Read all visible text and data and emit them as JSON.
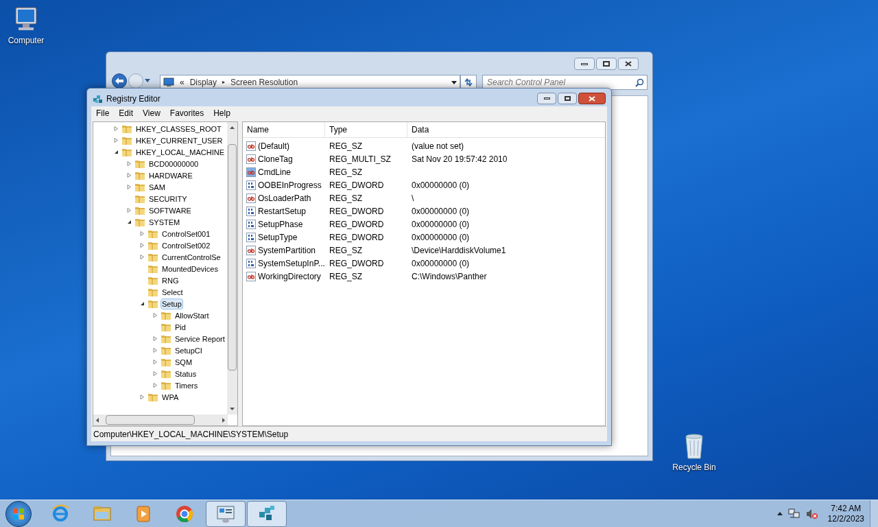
{
  "desktop_icons": [
    {
      "kind": "computer",
      "label": "Computer"
    },
    {
      "kind": "recycle-bin",
      "label": "Recycle Bin"
    }
  ],
  "control_panel": {
    "address": [
      {
        "kind": "chevrons",
        "text": "«"
      },
      {
        "kind": "crumb",
        "text": "Display"
      },
      {
        "kind": "sep",
        "text": "▸"
      },
      {
        "kind": "crumb",
        "text": "Screen Resolution"
      }
    ],
    "search": {
      "placeholder": "Search Control Panel"
    }
  },
  "registry_editor": {
    "title": "Registry Editor",
    "menu": [
      "File",
      "Edit",
      "View",
      "Favorites",
      "Help"
    ],
    "tree": [
      {
        "label": "HKEY_CLASSES_ROOT",
        "kind": "branch",
        "expanded": false,
        "selected": false
      },
      {
        "label": "HKEY_CURRENT_USER",
        "kind": "branch",
        "expanded": false,
        "selected": false
      },
      {
        "label": "HKEY_LOCAL_MACHINE",
        "kind": "branch",
        "expanded": true,
        "selected": false,
        "children": [
          {
            "label": "BCD00000000",
            "kind": "branch",
            "expanded": false,
            "selected": false
          },
          {
            "label": "HARDWARE",
            "kind": "branch",
            "expanded": false,
            "selected": false
          },
          {
            "label": "SAM",
            "kind": "branch",
            "expanded": false,
            "selected": false
          },
          {
            "label": "SECURITY",
            "kind": "leaf",
            "selected": false
          },
          {
            "label": "SOFTWARE",
            "kind": "branch",
            "expanded": false,
            "selected": false
          },
          {
            "label": "SYSTEM",
            "kind": "branch",
            "expanded": true,
            "selected": false,
            "children": [
              {
                "label": "ControlSet001",
                "kind": "branch",
                "expanded": false,
                "selected": false
              },
              {
                "label": "ControlSet002",
                "kind": "branch",
                "expanded": false,
                "selected": false
              },
              {
                "label": "CurrentControlSe",
                "kind": "branch",
                "expanded": false,
                "selected": false
              },
              {
                "label": "MountedDevices",
                "kind": "leaf",
                "selected": false
              },
              {
                "label": "RNG",
                "kind": "leaf",
                "selected": false
              },
              {
                "label": "Select",
                "kind": "leaf",
                "selected": false
              },
              {
                "label": "Setup",
                "kind": "branch",
                "expanded": true,
                "selected": true,
                "children": [
                  {
                    "label": "AllowStart",
                    "kind": "branch",
                    "expanded": false,
                    "selected": false
                  },
                  {
                    "label": "Pid",
                    "kind": "leaf",
                    "selected": false
                  },
                  {
                    "label": "Service Report",
                    "kind": "branch",
                    "expanded": false,
                    "selected": false
                  },
                  {
                    "label": "SetupCI",
                    "kind": "branch",
                    "expanded": false,
                    "selected": false
                  },
                  {
                    "label": "SQM",
                    "kind": "branch",
                    "expanded": false,
                    "selected": false
                  },
                  {
                    "label": "Status",
                    "kind": "branch",
                    "expanded": false,
                    "selected": false
                  },
                  {
                    "label": "Timers",
                    "kind": "branch",
                    "expanded": false,
                    "selected": false
                  }
                ]
              },
              {
                "label": "WPA",
                "kind": "branch",
                "expanded": false,
                "selected": false
              }
            ]
          }
        ]
      }
    ],
    "columns": [
      "Name",
      "Type",
      "Data"
    ],
    "rows": [
      {
        "kind": "string",
        "selected": false,
        "name": "(Default)",
        "type": "REG_SZ",
        "data": "(value not set)"
      },
      {
        "kind": "string",
        "selected": false,
        "name": "CloneTag",
        "type": "REG_MULTI_SZ",
        "data": "Sat Nov 20 19:57:42 2010"
      },
      {
        "kind": "string",
        "selected": true,
        "name": "CmdLine",
        "type": "REG_SZ",
        "data": ""
      },
      {
        "kind": "binary",
        "selected": false,
        "name": "OOBEInProgress",
        "type": "REG_DWORD",
        "data": "0x00000000 (0)"
      },
      {
        "kind": "string",
        "selected": false,
        "name": "OsLoaderPath",
        "type": "REG_SZ",
        "data": "\\"
      },
      {
        "kind": "binary",
        "selected": false,
        "name": "RestartSetup",
        "type": "REG_DWORD",
        "data": "0x00000000 (0)"
      },
      {
        "kind": "binary",
        "selected": false,
        "name": "SetupPhase",
        "type": "REG_DWORD",
        "data": "0x00000000 (0)"
      },
      {
        "kind": "binary",
        "selected": false,
        "name": "SetupType",
        "type": "REG_DWORD",
        "data": "0x00000000 (0)"
      },
      {
        "kind": "string",
        "selected": false,
        "name": "SystemPartition",
        "type": "REG_SZ",
        "data": "\\Device\\HarddiskVolume1"
      },
      {
        "kind": "binary",
        "selected": false,
        "name": "SystemSetupInP...",
        "type": "REG_DWORD",
        "data": "0x00000000 (0)"
      },
      {
        "kind": "string",
        "selected": false,
        "name": "WorkingDirectory",
        "type": "REG_SZ",
        "data": "C:\\Windows\\Panther"
      }
    ],
    "status_bar": "Computer\\HKEY_LOCAL_MACHINE\\SYSTEM\\Setup"
  },
  "taskbar": {
    "apps": [
      {
        "kind": "ie",
        "active": false
      },
      {
        "kind": "explorer",
        "active": false
      },
      {
        "kind": "media",
        "active": false
      },
      {
        "kind": "chrome",
        "active": false
      },
      {
        "kind": "control-panel",
        "active": true
      },
      {
        "kind": "regedit",
        "active": true
      }
    ],
    "time": "7:42 AM",
    "date": "12/2/2023"
  }
}
